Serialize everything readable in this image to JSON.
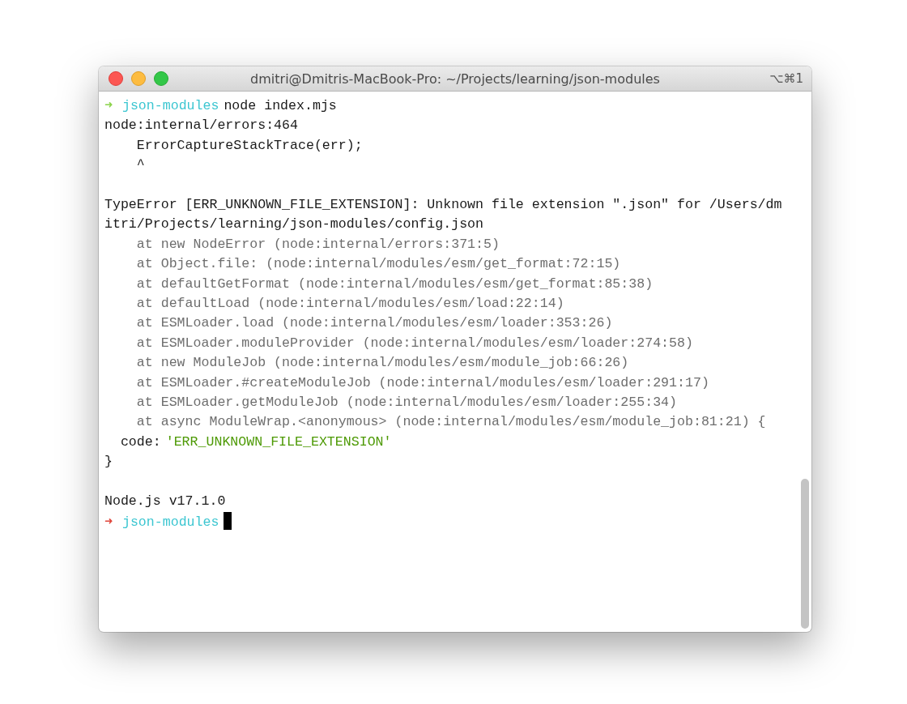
{
  "window": {
    "title": "dmitri@Dmitris-MacBook-Pro: ~/Projects/learning/json-modules",
    "shortcut": "⌥⌘1"
  },
  "lines": [
    {
      "kind": "prompt",
      "arrow": "➜",
      "failed": false,
      "dir": "json-modules",
      "command": "node index.mjs"
    },
    {
      "kind": "plain",
      "text": "node:internal/errors:464"
    },
    {
      "kind": "plain",
      "text": "    ErrorCaptureStackTrace(err);"
    },
    {
      "kind": "plain",
      "text": "    ^"
    },
    {
      "kind": "blank"
    },
    {
      "kind": "plain",
      "text": "TypeError [ERR_UNKNOWN_FILE_EXTENSION]: Unknown file extension \".json\" for /Users/dm"
    },
    {
      "kind": "plain",
      "text": "itri/Projects/learning/json-modules/config.json"
    },
    {
      "kind": "dim",
      "text": "    at new NodeError (node:internal/errors:371:5)"
    },
    {
      "kind": "dim",
      "text": "    at Object.file: (node:internal/modules/esm/get_format:72:15)"
    },
    {
      "kind": "dim",
      "text": "    at defaultGetFormat (node:internal/modules/esm/get_format:85:38)"
    },
    {
      "kind": "dim",
      "text": "    at defaultLoad (node:internal/modules/esm/load:22:14)"
    },
    {
      "kind": "dim",
      "text": "    at ESMLoader.load (node:internal/modules/esm/loader:353:26)"
    },
    {
      "kind": "dim",
      "text": "    at ESMLoader.moduleProvider (node:internal/modules/esm/loader:274:58)"
    },
    {
      "kind": "dim",
      "text": "    at new ModuleJob (node:internal/modules/esm/module_job:66:26)"
    },
    {
      "kind": "dim",
      "text": "    at ESMLoader.#createModuleJob (node:internal/modules/esm/loader:291:17)"
    },
    {
      "kind": "dim",
      "text": "    at ESMLoader.getModuleJob (node:internal/modules/esm/loader:255:34)"
    },
    {
      "kind": "dim",
      "text": "    at async ModuleWrap.<anonymous> (node:internal/modules/esm/module_job:81:21) {"
    },
    {
      "kind": "code",
      "key": "  code:",
      "value": "'ERR_UNKNOWN_FILE_EXTENSION'"
    },
    {
      "kind": "plain",
      "text": "}"
    },
    {
      "kind": "blank"
    },
    {
      "kind": "plain",
      "text": "Node.js v17.1.0"
    },
    {
      "kind": "prompt",
      "arrow": "➜",
      "failed": true,
      "dir": "json-modules",
      "cursor": true
    }
  ]
}
